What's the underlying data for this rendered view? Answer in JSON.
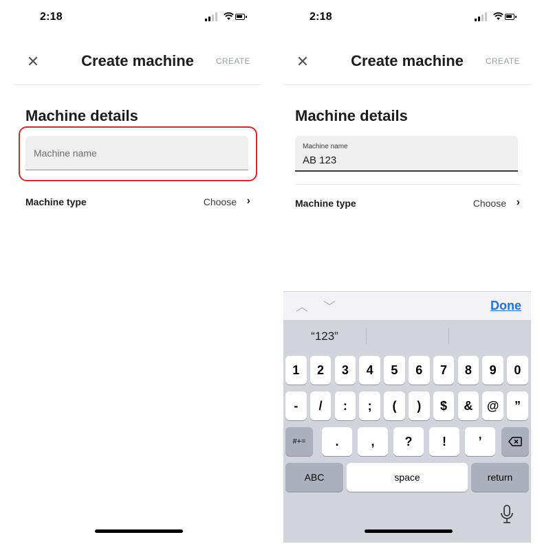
{
  "left_screen": {
    "status_time": "2:18",
    "title": "Create machine",
    "create_label": "CREATE",
    "close_icon": "close-icon",
    "section_title": "Machine details",
    "name_field": {
      "placeholder": "Machine name",
      "value": ""
    },
    "type_label": "Machine type",
    "type_choose": "Choose",
    "highlight_color": "#e0242a"
  },
  "right_screen": {
    "status_time": "2:18",
    "title": "Create machine",
    "create_label": "CREATE",
    "section_title": "Machine details",
    "name_field": {
      "label": "Machine name",
      "value": "AB 123"
    },
    "type_label": "Machine type",
    "type_choose": "Choose",
    "keyboard": {
      "done_label": "Done",
      "suggestion": "“123”",
      "row1": [
        "1",
        "2",
        "3",
        "4",
        "5",
        "6",
        "7",
        "8",
        "9",
        "0"
      ],
      "row2": [
        "-",
        "/",
        ":",
        ";",
        "(",
        ")",
        "$",
        "&",
        "@",
        "”"
      ],
      "row3": [
        "#+=",
        ".",
        ",",
        "?",
        "!",
        "’"
      ],
      "abc_label": "ABC",
      "space_label": "space",
      "return_label": "return"
    }
  },
  "colors": {
    "done_blue": "#1a73e8",
    "keyboard_bg": "#d1d4da"
  }
}
